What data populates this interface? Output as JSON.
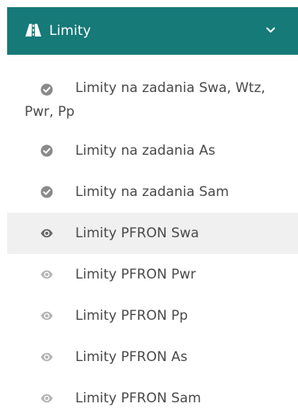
{
  "header": {
    "title": "Limity",
    "icon": "road-icon",
    "toggle_icon": "chevron-down-icon",
    "background": "#167a79"
  },
  "items": [
    {
      "label": "Limity na zadania Swa, Wtz, Pwr, Pp",
      "icon": "check-circle-icon",
      "active": false
    },
    {
      "label": "Limity na zadania As",
      "icon": "check-circle-icon",
      "active": false
    },
    {
      "label": "Limity na zadania Sam",
      "icon": "check-circle-icon",
      "active": false
    },
    {
      "label": "Limity PFRON Swa",
      "icon": "eye-icon",
      "active": true
    },
    {
      "label": "Limity PFRON Pwr",
      "icon": "eye-icon",
      "active": false
    },
    {
      "label": "Limity PFRON Pp",
      "icon": "eye-icon",
      "active": false
    },
    {
      "label": "Limity PFRON As",
      "icon": "eye-icon",
      "active": false
    },
    {
      "label": "Limity PFRON Sam",
      "icon": "eye-icon",
      "active": false
    }
  ],
  "colors": {
    "check_icon": "#8a8a8a",
    "eye_icon_active": "#6a6a6a",
    "eye_icon": "#b5b5b5",
    "active_row": "#f0f0f0",
    "text": "#4a4a4a"
  }
}
